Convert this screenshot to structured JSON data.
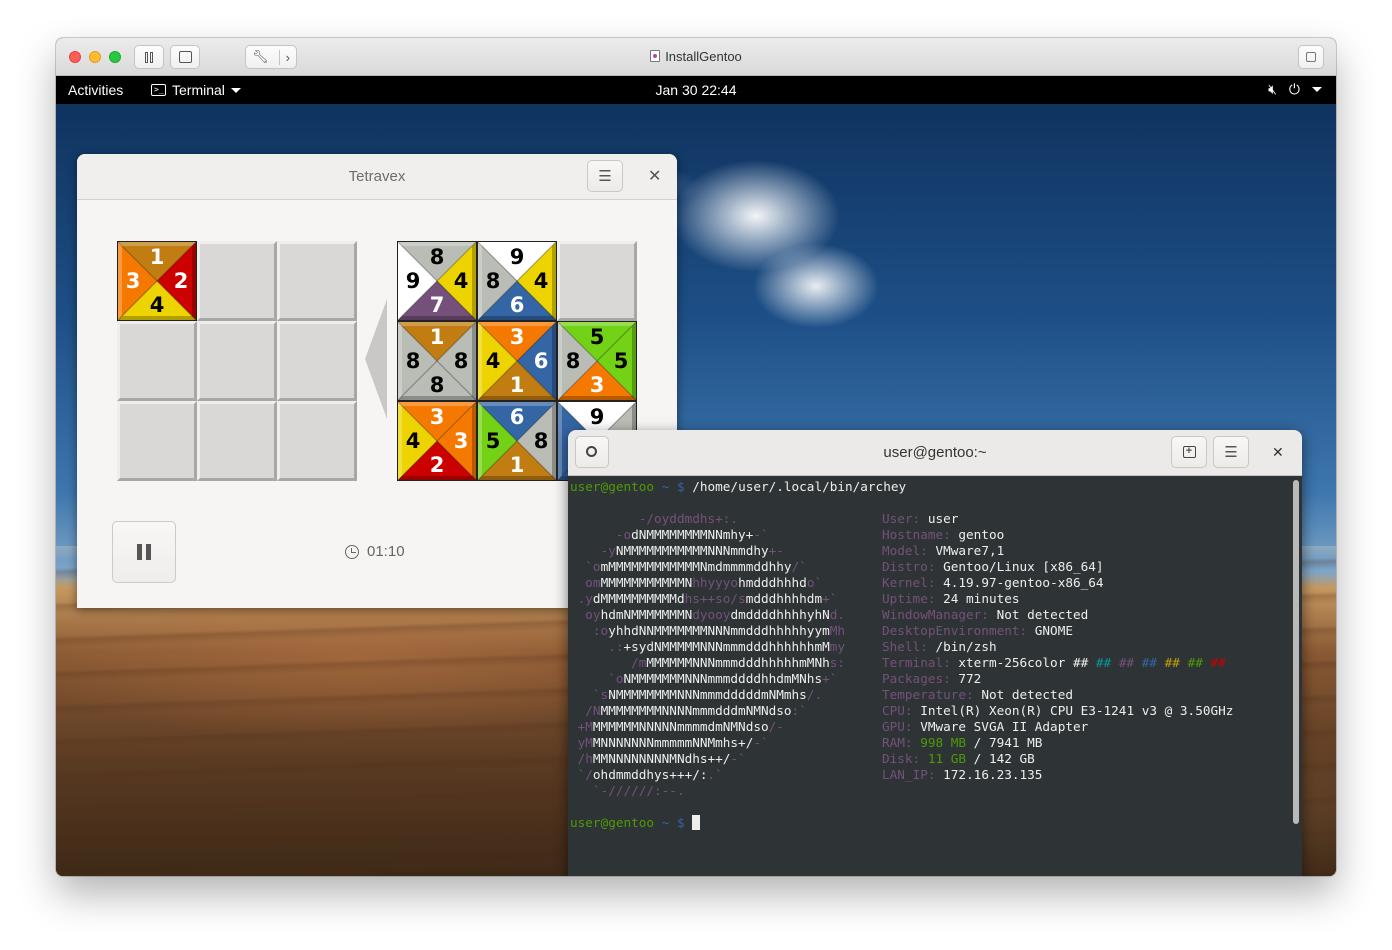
{
  "vm_window": {
    "title": "InstallGentoo",
    "toolbar": [
      "pause",
      "snapshot",
      "settings",
      "forward"
    ]
  },
  "gnome": {
    "activities": "Activities",
    "app_menu": "Terminal",
    "clock": "Jan 30  22:44"
  },
  "tetravex": {
    "title": "Tetravex",
    "timer": "01:10",
    "placed_tiles": [
      {
        "top": "1",
        "right": "2",
        "bottom": "4",
        "left": "3",
        "colors": [
          "#c17d11",
          "#cc0000",
          "#edd400",
          "#f57900"
        ],
        "text": [
          "#ffffff",
          "#ffffff",
          "#000000",
          "#ffffff"
        ]
      }
    ],
    "source_tiles": [
      {
        "top": "8",
        "right": "4",
        "bottom": "7",
        "left": "9",
        "colors": [
          "#babdb6",
          "#edd400",
          "#75507b",
          "#ffffff"
        ],
        "text": [
          "#000000",
          "#000000",
          "#ffffff",
          "#000000"
        ]
      },
      {
        "top": "9",
        "right": "4",
        "bottom": "6",
        "left": "8",
        "colors": [
          "#ffffff",
          "#edd400",
          "#3465a4",
          "#babdb6"
        ],
        "text": [
          "#000000",
          "#000000",
          "#ffffff",
          "#000000"
        ]
      },
      {
        "top": "1",
        "right": "8",
        "bottom": "8",
        "left": "8",
        "colors": [
          "#c17d11",
          "#babdb6",
          "#babdb6",
          "#babdb6"
        ],
        "text": [
          "#ffffff",
          "#000000",
          "#000000",
          "#000000"
        ]
      },
      {
        "top": "3",
        "right": "6",
        "bottom": "1",
        "left": "4",
        "colors": [
          "#f57900",
          "#3465a4",
          "#c17d11",
          "#edd400"
        ],
        "text": [
          "#ffffff",
          "#ffffff",
          "#ffffff",
          "#000000"
        ]
      },
      {
        "top": "5",
        "right": "5",
        "bottom": "3",
        "left": "8",
        "colors": [
          "#73d216",
          "#73d216",
          "#f57900",
          "#babdb6"
        ],
        "text": [
          "#000000",
          "#000000",
          "#ffffff",
          "#000000"
        ]
      },
      {
        "top": "3",
        "right": "3",
        "bottom": "2",
        "left": "4",
        "colors": [
          "#f57900",
          "#f57900",
          "#cc0000",
          "#edd400"
        ],
        "text": [
          "#ffffff",
          "#ffffff",
          "#ffffff",
          "#000000"
        ]
      },
      {
        "top": "6",
        "right": "8",
        "bottom": "1",
        "left": "5",
        "colors": [
          "#3465a4",
          "#babdb6",
          "#c17d11",
          "#73d216"
        ],
        "text": [
          "#ffffff",
          "#000000",
          "#ffffff",
          "#000000"
        ]
      },
      {
        "top": "9",
        "right": "",
        "bottom": "",
        "left": "",
        "colors": [
          "#ffffff",
          "#babdb6",
          "#3465a4",
          "#3465a4"
        ],
        "text": [
          "#000000",
          "#000000",
          "#ffffff",
          "#ffffff"
        ]
      }
    ]
  },
  "terminal": {
    "title": "user@gentoo:~",
    "prompt_user": "user@gentoo",
    "prompt_rest": " ~ $ ",
    "command": "/home/user/.local/bin/archey",
    "info": [
      {
        "key": "User:",
        "value": "user"
      },
      {
        "key": "Hostname:",
        "value": "gentoo"
      },
      {
        "key": "Model:",
        "value": "VMware7,1"
      },
      {
        "key": "Distro:",
        "value": "Gentoo/Linux [x86_64]"
      },
      {
        "key": "Kernel:",
        "value": "4.19.97-gentoo-x86_64"
      },
      {
        "key": "Uptime:",
        "value": "24 minutes"
      },
      {
        "key": "WindowManager:",
        "value": "Not detected"
      },
      {
        "key": "DesktopEnvironment:",
        "value": "GNOME"
      },
      {
        "key": "Shell:",
        "value": "/bin/zsh"
      },
      {
        "key": "Terminal:",
        "value": "xterm-256color ##"
      },
      {
        "key": "Packages:",
        "value": "772"
      },
      {
        "key": "Temperature:",
        "value": "Not detected"
      },
      {
        "key": "CPU:",
        "value": "Intel(R) Xeon(R) CPU E3-1241 v3 @ 3.50GHz"
      },
      {
        "key": "GPU:",
        "value": "VMware SVGA II Adapter"
      },
      {
        "key": "RAM:",
        "value": "998 MB / 7941 MB"
      },
      {
        "key": "Disk:",
        "value": "11 GB / 142 GB"
      },
      {
        "key": "LAN_IP:",
        "value": "172.16.23.135"
      }
    ],
    "color_swatches": [
      {
        "text": "##",
        "color": "#06989a"
      },
      {
        "text": "##",
        "color": "#75507b"
      },
      {
        "text": "##",
        "color": "#3465a4"
      },
      {
        "text": "##",
        "color": "#c4a000"
      },
      {
        "text": "##",
        "color": "#4e9a06"
      },
      {
        "text": "##",
        "color": "#cc0000"
      }
    ],
    "ascii_art": [
      [
        {
          "c": "p",
          "t": "         -/oyddmdhs+:."
        }
      ],
      [
        {
          "c": "p",
          "t": "      -o"
        },
        {
          "c": "w",
          "t": "dNMMMMMMMMNNmhy+"
        },
        {
          "c": "p",
          "t": "-`"
        }
      ],
      [
        {
          "c": "p",
          "t": "    -y"
        },
        {
          "c": "w",
          "t": "NMMMMMMMMMMMNNNmmdhy"
        },
        {
          "c": "p",
          "t": "+-"
        }
      ],
      [
        {
          "c": "p",
          "t": "  `o"
        },
        {
          "c": "w",
          "t": "mMMMMMMMMMMMMNmdmmmmddhhy"
        },
        {
          "c": "p",
          "t": "/`"
        }
      ],
      [
        {
          "c": "p",
          "t": "  om"
        },
        {
          "c": "w",
          "t": "MMMMMMMMMMMN"
        },
        {
          "c": "p",
          "t": "hhyyyo"
        },
        {
          "c": "w",
          "t": "hmdddhhhd"
        },
        {
          "c": "p",
          "t": "o`"
        }
      ],
      [
        {
          "c": "p",
          "t": " .y"
        },
        {
          "c": "w",
          "t": "dMMMMMMMMMMd"
        },
        {
          "c": "p",
          "t": "hs++so/s"
        },
        {
          "c": "w",
          "t": "mdddhhhhdm"
        },
        {
          "c": "p",
          "t": "+`"
        }
      ],
      [
        {
          "c": "p",
          "t": "  oy"
        },
        {
          "c": "w",
          "t": "hdmNMMMMMMMN"
        },
        {
          "c": "p",
          "t": "dyooy"
        },
        {
          "c": "w",
          "t": "dmddddhhhhyhN"
        },
        {
          "c": "p",
          "t": "d."
        }
      ],
      [
        {
          "c": "p",
          "t": "   :o"
        },
        {
          "c": "w",
          "t": "yhhdNNMMMMMMMNNNmmdddhhhhhyym"
        },
        {
          "c": "p",
          "t": "Mh"
        }
      ],
      [
        {
          "c": "p",
          "t": "     .:"
        },
        {
          "c": "w",
          "t": "+sydNMMMMMNNNmmmdddhhhhhhmM"
        },
        {
          "c": "p",
          "t": "my"
        }
      ],
      [
        {
          "c": "p",
          "t": "        /m"
        },
        {
          "c": "w",
          "t": "MMMMMMNNNmmmdddhhhhhmMNh"
        },
        {
          "c": "p",
          "t": "s:"
        }
      ],
      [
        {
          "c": "p",
          "t": "     `o"
        },
        {
          "c": "w",
          "t": "NMMMMMMMNNNmmmddddhhdmMNhs"
        },
        {
          "c": "p",
          "t": "+`"
        }
      ],
      [
        {
          "c": "p",
          "t": "   `s"
        },
        {
          "c": "w",
          "t": "NMMMMMMMMNNNmmmdddddmNMmhs"
        },
        {
          "c": "p",
          "t": "/."
        }
      ],
      [
        {
          "c": "p",
          "t": "  /N"
        },
        {
          "c": "w",
          "t": "MMMMMMMMNNNNmmmdddmNMNdso"
        },
        {
          "c": "p",
          "t": ":`"
        }
      ],
      [
        {
          "c": "p",
          "t": " +M"
        },
        {
          "c": "w",
          "t": "MMMMMMNNNNNmmmmdmNMNdso"
        },
        {
          "c": "p",
          "t": "/-"
        }
      ],
      [
        {
          "c": "p",
          "t": " yM"
        },
        {
          "c": "w",
          "t": "MNNNNNNNmmmmmNNMmhs+/"
        },
        {
          "c": "p",
          "t": "-`"
        }
      ],
      [
        {
          "c": "p",
          "t": " /h"
        },
        {
          "c": "w",
          "t": "MMNNNNNNNNMNdhs++/"
        },
        {
          "c": "p",
          "t": "-`"
        }
      ],
      [
        {
          "c": "p",
          "t": " `/"
        },
        {
          "c": "w",
          "t": "ohdmmddhys+++/:"
        },
        {
          "c": "p",
          "t": ".`"
        }
      ],
      [
        {
          "c": "p",
          "t": "   `-//////:--."
        }
      ]
    ]
  }
}
